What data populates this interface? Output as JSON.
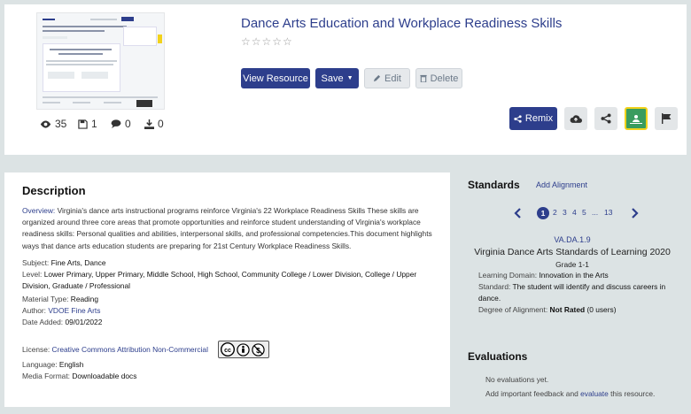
{
  "resource": {
    "title": "Dance Arts Education and Workplace Readiness Skills",
    "rating_stars": "☆☆☆☆☆",
    "stats": {
      "views": "35",
      "saves": "1",
      "comments": "0",
      "downloads": "0"
    }
  },
  "actions": {
    "view_resource": "View Resource",
    "save": "Save",
    "edit": "Edit",
    "delete": "Delete",
    "remix": "Remix"
  },
  "description": {
    "heading": "Description",
    "overview_label": "Overview:",
    "overview": "Virginia's dance arts instructional programs reinforce Virginia's 22 Workplace Readiness Skills These skills are organized around three core areas that promote opportunities and reinforce student understanding of Virginia's workplace readiness skills: Personal qualities and abilities, interpersonal skills, and professional competencies.This document highlights ways that dance arts education students are preparing for 21st Century Workplace Readiness Skills.",
    "subject_label": "Subject:",
    "subject": "Fine Arts, Dance",
    "level_label": "Level:",
    "level": "Lower Primary, Upper Primary, Middle School, High School, Community College / Lower Division, College / Upper Division, Graduate / Professional",
    "material_label": "Material Type:",
    "material": "Reading",
    "author_label": "Author:",
    "author": "VDOE Fine Arts",
    "date_label": "Date Added:",
    "date": "09/01/2022",
    "license_label": "License:",
    "license": "Creative Commons Attribution Non-Commercial",
    "language_label": "Language:",
    "language": "English",
    "media_label": "Media Format:",
    "media": "Downloadable docs"
  },
  "standards": {
    "heading": "Standards",
    "add_alignment": "Add Alignment",
    "pager": {
      "current": "1",
      "pages": [
        "2",
        "3",
        "4",
        "5"
      ],
      "ellipsis": "...",
      "last": "13"
    },
    "code": "VA.DA.1.9",
    "name": "Virginia Dance Arts Standards of Learning 2020",
    "grade": "Grade 1-1",
    "domain_label": "Learning Domain:",
    "domain": "Innovation in the Arts",
    "standard_label": "Standard:",
    "standard": "The student will identify and discuss careers in dance.",
    "degree_label": "Degree of Alignment:",
    "degree": "Not Rated",
    "degree_users": "(0 users)"
  },
  "evaluations": {
    "heading": "Evaluations",
    "none": "No evaluations yet.",
    "prompt_before": "Add important feedback and",
    "prompt_link": "evaluate",
    "prompt_after": "this resource."
  },
  "colors": {
    "primary": "#2d3e8c",
    "accent_green": "#3a9c5e",
    "accent_yellow": "#f2d21c"
  }
}
